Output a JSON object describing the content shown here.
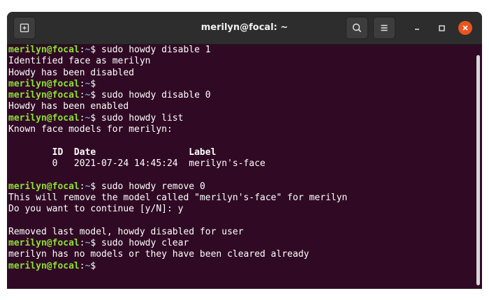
{
  "window": {
    "title": "merilyn@focal: ~"
  },
  "titlebar_icons": {
    "new_tab": "new-tab-icon",
    "search": "search-icon",
    "menu": "hamburger-menu-icon",
    "minimize": "minimize-icon",
    "maximize": "maximize-icon",
    "close": "close-icon"
  },
  "colors": {
    "terminal_bg": "#300a24",
    "prompt_user": "#8ae234",
    "prompt_path": "#729fcf",
    "close_button": "#e95420"
  },
  "prompt": {
    "user_host": "merilyn@focal",
    "colon": ":",
    "path": "~",
    "symbol": "$"
  },
  "terminal_lines": [
    {
      "type": "cmd",
      "command": " sudo howdy disable 1"
    },
    {
      "type": "out",
      "text": "Identified face as merilyn"
    },
    {
      "type": "out",
      "text": "Howdy has been disabled"
    },
    {
      "type": "cmd",
      "command": ""
    },
    {
      "type": "cmd",
      "command": " sudo howdy disable 0"
    },
    {
      "type": "out",
      "text": "Howdy has been enabled"
    },
    {
      "type": "cmd",
      "command": " sudo howdy list"
    },
    {
      "type": "out",
      "text": "Known face models for merilyn:"
    },
    {
      "type": "out",
      "text": ""
    },
    {
      "type": "hdr",
      "text": "        ID  Date                 Label"
    },
    {
      "type": "out",
      "text": "        0   2021-07-24 14:45:24  merilyn's-face"
    },
    {
      "type": "out",
      "text": ""
    },
    {
      "type": "cmd",
      "command": " sudo howdy remove 0"
    },
    {
      "type": "out",
      "text": "This will remove the model called \"merilyn's-face\" for merilyn"
    },
    {
      "type": "out",
      "text": "Do you want to continue [y/N]: y"
    },
    {
      "type": "out",
      "text": ""
    },
    {
      "type": "out",
      "text": "Removed last model, howdy disabled for user"
    },
    {
      "type": "cmd",
      "command": " sudo howdy clear"
    },
    {
      "type": "out",
      "text": "merilyn has no models or they have been cleared already"
    },
    {
      "type": "cmd",
      "command": ""
    }
  ]
}
